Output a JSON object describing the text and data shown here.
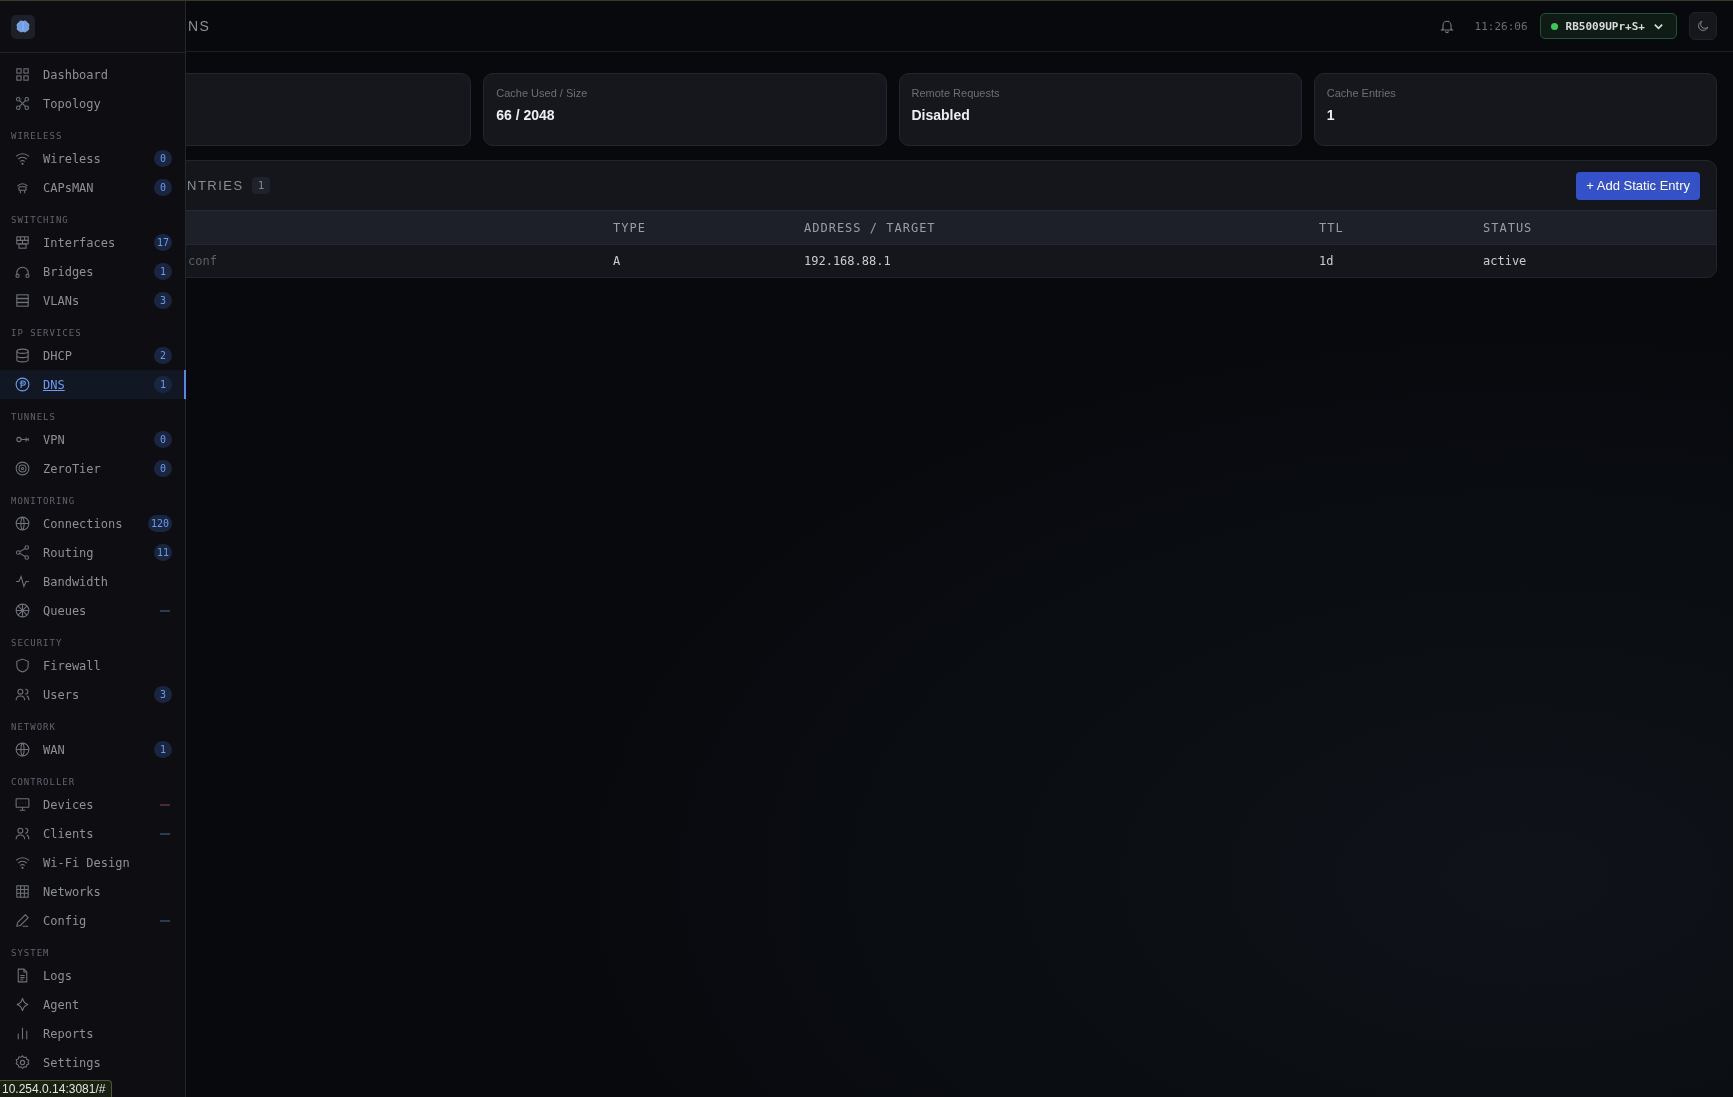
{
  "header": {
    "page_title": "NS",
    "time": "11:26:06",
    "device": {
      "name": "RB5009UPr+S+",
      "online": true
    }
  },
  "sidebar": {
    "sections": [
      {
        "items": [
          {
            "label": "Dashboard",
            "selected": false
          },
          {
            "label": "Topology",
            "selected": false
          }
        ]
      },
      {
        "title": "WIRELESS",
        "items": [
          {
            "label": "Wireless",
            "selected": false,
            "badge": "0"
          },
          {
            "label": "CAPsMAN",
            "selected": false,
            "badge": "0"
          }
        ]
      },
      {
        "title": "SWITCHING",
        "items": [
          {
            "label": "Interfaces",
            "selected": false,
            "badge": "17"
          },
          {
            "label": "Bridges",
            "selected": false,
            "badge": "1"
          },
          {
            "label": "VLANs",
            "selected": false,
            "badge": "3"
          }
        ]
      },
      {
        "title": "IP SERVICES",
        "items": [
          {
            "label": "DHCP",
            "selected": false,
            "badge": "2"
          },
          {
            "label": "DNS",
            "selected": true,
            "badge": "1"
          }
        ]
      },
      {
        "title": "TUNNELS",
        "items": [
          {
            "label": "VPN",
            "selected": false,
            "badge": "0"
          },
          {
            "label": "ZeroTier",
            "selected": false,
            "badge": "0"
          }
        ]
      },
      {
        "title": "MONITORING",
        "items": [
          {
            "label": "Connections",
            "selected": false,
            "badge": "120"
          },
          {
            "label": "Routing",
            "selected": false,
            "badge": "11"
          },
          {
            "label": "Bandwidth",
            "selected": false
          },
          {
            "label": "Queues",
            "selected": false,
            "color": "#2b3a55"
          }
        ]
      },
      {
        "title": "SECURITY",
        "items": [
          {
            "label": "Firewall",
            "selected": false
          },
          {
            "label": "Users",
            "selected": false,
            "badge": "3"
          }
        ]
      },
      {
        "title": "NETWORK",
        "items": [
          {
            "label": "WAN",
            "selected": false,
            "badge": "1"
          }
        ]
      },
      {
        "title": "CONTROLLER",
        "items": [
          {
            "label": "Devices",
            "selected": false,
            "color": "#4a2a30"
          },
          {
            "label": "Clients",
            "selected": false,
            "color": "#2b3a55"
          },
          {
            "label": "Wi-Fi Design",
            "selected": false
          },
          {
            "label": "Networks",
            "selected": false
          },
          {
            "label": "Config",
            "selected": false,
            "color": "#2b3a55"
          }
        ]
      },
      {
        "title": "SYSTEM",
        "items": [
          {
            "label": "Logs",
            "selected": false
          },
          {
            "label": "Agent",
            "selected": false
          },
          {
            "label": "Reports",
            "selected": false
          },
          {
            "label": "Settings",
            "selected": false
          }
        ]
      }
    ]
  },
  "stats": [
    {
      "kind": "blank"
    },
    {
      "kind": "text",
      "label": "Cache Used / Size",
      "value": "66 / 2048"
    },
    {
      "kind": "text",
      "label": "Remote Requests",
      "value": "Disabled"
    },
    {
      "kind": "text",
      "label": "Cache Entries",
      "value": "1"
    }
  ],
  "entries": {
    "title": "NTRIES",
    "count": "1",
    "add_button": "+ Add Static Entry",
    "columns": [
      "",
      "TYPE",
      "ADDRESS / TARGET",
      "TTL",
      "STATUS"
    ],
    "rows": [
      [
        "conf",
        "A",
        "192.168.88.1",
        "1d",
        "active"
      ]
    ]
  },
  "status_bar": {
    "url": "10.254.0.14:3081/#"
  }
}
